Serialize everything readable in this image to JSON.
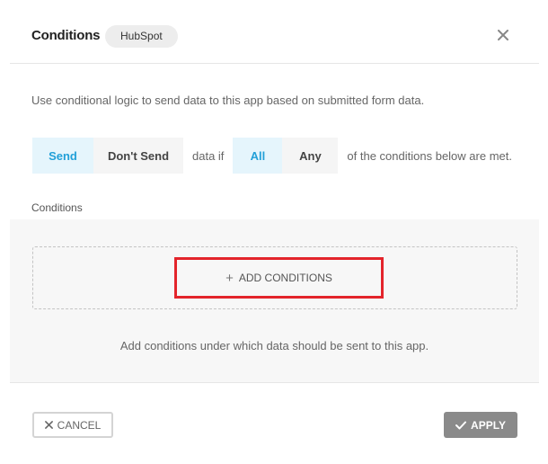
{
  "header": {
    "title": "Conditions",
    "app_name": "HubSpot",
    "close_icon": "close-icon"
  },
  "description": "Use conditional logic to send data to this app based on submitted form data.",
  "logic": {
    "action_options": [
      "Send",
      "Don't Send"
    ],
    "action_selected": "Send",
    "connector_text": "data if",
    "match_options": [
      "All",
      "Any"
    ],
    "match_selected": "All",
    "tail_text": "of the conditions below are met."
  },
  "conditions": {
    "section_label": "Conditions",
    "add_button_label": "ADD CONDITIONS",
    "add_icon": "plus-icon",
    "empty_hint": "Add conditions under which data should be sent to this app."
  },
  "footer": {
    "cancel_label": "CANCEL",
    "cancel_icon": "x-icon",
    "apply_label": "APPLY",
    "apply_icon": "check-icon"
  },
  "colors": {
    "active_text": "#22a0d8",
    "active_bg": "#e5f5fc",
    "highlight_border": "#e3242b",
    "apply_bg": "#8a8a8a"
  }
}
